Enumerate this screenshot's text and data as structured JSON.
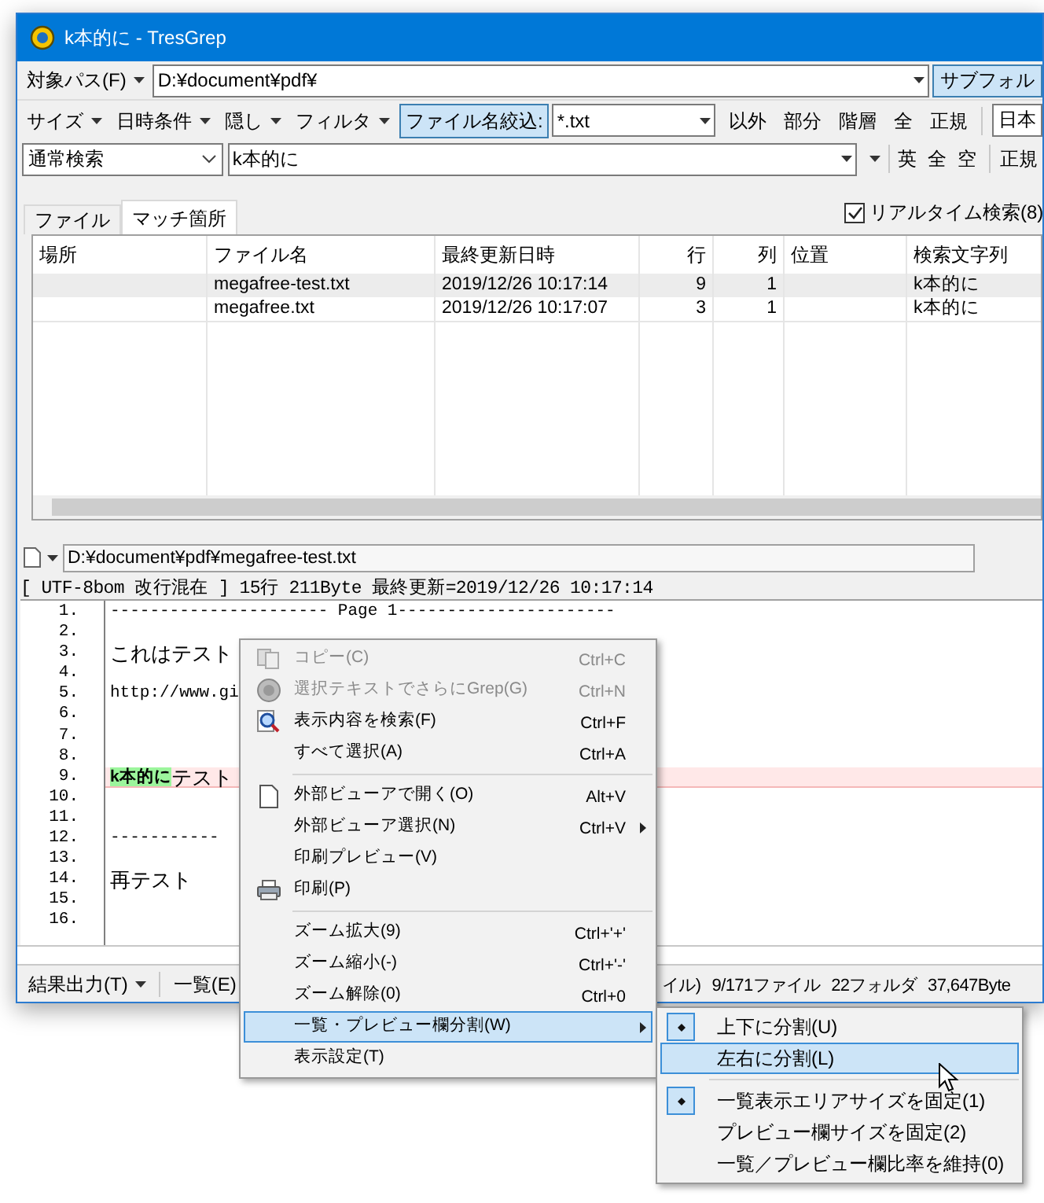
{
  "window": {
    "title": "k本的に - TresGrep"
  },
  "path_bar": {
    "label": "対象パス(F)",
    "value": "D:¥document¥pdf¥",
    "subfolder_button": "サブフォル"
  },
  "filter_bar": {
    "menus": [
      "サイズ",
      "日時条件",
      "隠し",
      "フィルタ"
    ],
    "filename_filter": {
      "label": "ファイル名絞込:",
      "on": true,
      "value": "*.txt"
    },
    "options": [
      "以外",
      "部分",
      "階層",
      "全",
      "正規"
    ],
    "encoding": "日本"
  },
  "search_bar": {
    "mode": "通常検索",
    "query": "k本的に",
    "options": [
      "英",
      "全",
      "空"
    ],
    "regex": "正規"
  },
  "tabs": [
    {
      "label": "ファイル",
      "selected": false
    },
    {
      "label": "マッチ箇所",
      "selected": true
    }
  ],
  "realtime": {
    "label": "リアルタイム検索(8)",
    "checked": true
  },
  "table": {
    "columns": [
      "場所",
      "ファイル名",
      "最終更新日時",
      "行",
      "列",
      "位置",
      "検索文字列"
    ],
    "rows": [
      {
        "file": "megafree-test.txt",
        "modified": "2019/12/26 10:17:14",
        "line": "9",
        "col": "1",
        "match": "k本的に",
        "selected": true
      },
      {
        "file": "megafree.txt",
        "modified": "2019/12/26 10:17:07",
        "line": "3",
        "col": "1",
        "match": "k本的に",
        "selected": false
      }
    ]
  },
  "preview": {
    "path": "D:¥document¥pdf¥megafree-test.txt",
    "info": "[ UTF-8bom 改行混在 ] 15行 211Byte 最終更新=2019/12/26 10:17:14",
    "lines": [
      {
        "number": "1.",
        "text": "---------------------- Page 1----------------------"
      },
      {
        "number": "2."
      },
      {
        "number": "3.",
        "text": "これはテスト"
      },
      {
        "number": "4."
      },
      {
        "number": "5.",
        "text": "http://www.gi"
      },
      {
        "number": "6."
      },
      {
        "number": "7."
      },
      {
        "number": "8."
      },
      {
        "number": "9.",
        "match": "k本的に",
        "text": "テスト",
        "highlight": true
      },
      {
        "number": "10."
      },
      {
        "number": "11."
      },
      {
        "number": "12.",
        "text": "-----------"
      },
      {
        "number": "13."
      },
      {
        "number": "14.",
        "text": "再テスト"
      },
      {
        "number": "15."
      },
      {
        "number": "16."
      }
    ]
  },
  "status_bar": {
    "menus": [
      "結果出力(T)",
      "一覧(E)"
    ],
    "fragment": "イル)",
    "files": "9/171ファイル",
    "folders": "22フォルダ",
    "size": "37,647Byte"
  },
  "context_menu": {
    "items": [
      {
        "kind": "copy",
        "label": "コピー(C)",
        "shortcut": "Ctrl+C",
        "disabled": true,
        "selected": false
      },
      {
        "kind": "logo",
        "label": "選択テキストでさらにGrep(G)",
        "shortcut": "Ctrl+N",
        "disabled": true,
        "selected": false
      },
      {
        "kind": "search",
        "label": "表示内容を検索(F)",
        "shortcut": "Ctrl+F",
        "disabled": false,
        "selected": false
      },
      {
        "kind": "item",
        "label": "すべて選択(A)",
        "shortcut": "Ctrl+A",
        "disabled": false,
        "selected": false
      },
      {
        "kind": "separator"
      },
      {
        "kind": "page",
        "label": "外部ビューアで開く(O)",
        "shortcut": "Alt+V",
        "disabled": false,
        "selected": false
      },
      {
        "kind": "item",
        "label": "外部ビューア選択(N)",
        "shortcut": "Ctrl+V",
        "submenu": true,
        "disabled": false,
        "selected": false
      },
      {
        "kind": "item",
        "label": "印刷プレビュー(V)",
        "disabled": false,
        "selected": false
      },
      {
        "kind": "printer",
        "label": "印刷(P)",
        "disabled": false,
        "selected": false
      },
      {
        "kind": "separator"
      },
      {
        "kind": "item",
        "label": "ズーム拡大(9)",
        "shortcut": "Ctrl+'+'",
        "disabled": false,
        "selected": false
      },
      {
        "kind": "item",
        "label": "ズーム縮小(-)",
        "shortcut": "Ctrl+'-'",
        "disabled": false,
        "selected": false
      },
      {
        "kind": "item",
        "label": "ズーム解除(0)",
        "shortcut": "Ctrl+0",
        "disabled": false,
        "selected": false
      },
      {
        "kind": "item",
        "label": "一覧・プレビュー欄分割(W)",
        "submenu": true,
        "disabled": false,
        "selected": true
      },
      {
        "kind": "item",
        "label": "表示設定(T)",
        "disabled": false,
        "selected": false
      }
    ]
  },
  "submenu": {
    "items": [
      {
        "kind": "item",
        "label": "上下に分割(U)",
        "checked": true,
        "selected": false
      },
      {
        "kind": "item",
        "label": "左右に分割(L)",
        "checked": false,
        "selected": true
      },
      {
        "kind": "separator"
      },
      {
        "kind": "item",
        "label": "一覧表示エリアサイズを固定(1)",
        "checked": true,
        "selected": false
      },
      {
        "kind": "item",
        "label": "プレビュー欄サイズを固定(2)",
        "checked": false,
        "selected": false
      },
      {
        "kind": "item",
        "label": "一覧／プレビュー欄比率を維持(0)",
        "checked": false,
        "selected": false
      }
    ]
  }
}
